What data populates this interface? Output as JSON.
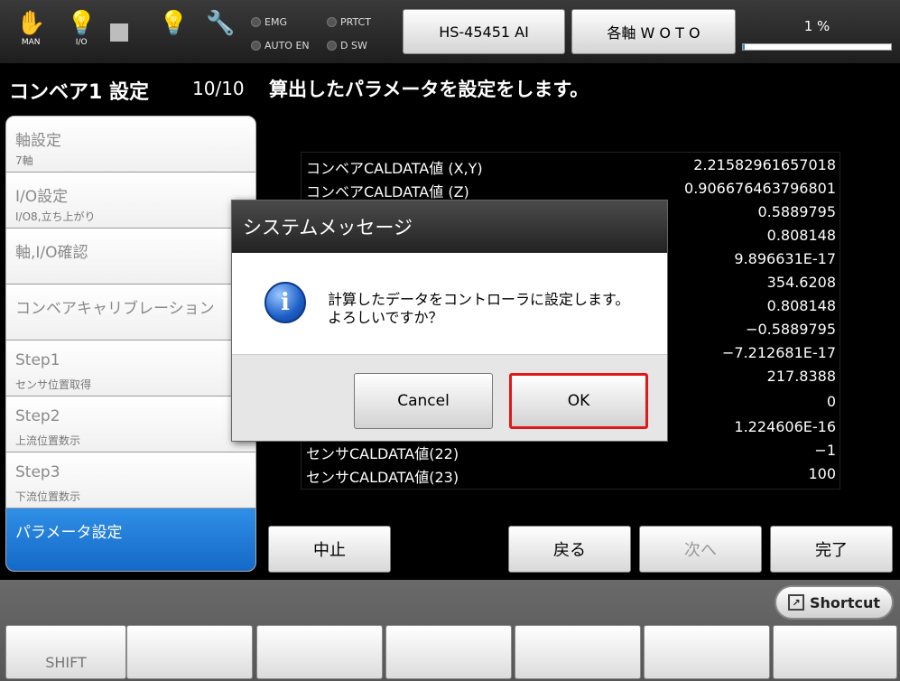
{
  "toolbar": {
    "icons": [
      {
        "name": "hand-icon",
        "caption": "MAN"
      },
      {
        "name": "io-bulb-icon",
        "caption": "I/O"
      },
      {
        "name": "stop-square-icon",
        "caption": ""
      },
      {
        "name": "bulb-icon",
        "caption": ""
      },
      {
        "name": "wrench-icon",
        "caption": ""
      }
    ],
    "leds": {
      "emg": "EMG",
      "prtct": "PRTCT",
      "auto_en": "AUTO EN",
      "dsw": "D SW"
    },
    "model_button": "HS-45451 AI",
    "axis_button": "各軸 W O T O",
    "progress_text": "1 %",
    "progress_fraction": 0.01
  },
  "sidebar": {
    "title": "コンベア1 設定",
    "page": "10/10",
    "steps": [
      {
        "title": "軸設定",
        "sub": "7軸"
      },
      {
        "title": "I/O設定",
        "sub": "I/O8,立ち上がり"
      },
      {
        "title": "軸,I/O確認",
        "sub": ""
      },
      {
        "title": "コンベアキャリブレーション",
        "sub": ""
      },
      {
        "title": "Step1",
        "sub": "センサ位置取得"
      },
      {
        "title": "Step2",
        "sub": "上流位置数示"
      },
      {
        "title": "Step3",
        "sub": "下流位置数示"
      },
      {
        "title": "パラメータ設定",
        "sub": ""
      }
    ]
  },
  "main": {
    "title": "算出したパラメータを設定をします。",
    "rows": [
      {
        "label": "コンベアCALDATA値 (X,Y)",
        "value": "2.21582961657018"
      },
      {
        "label": "コンベアCALDATA値 (Z)",
        "value": "0.906676463796801"
      },
      {
        "label": "",
        "value": "0.5889795"
      },
      {
        "label": "",
        "value": "0.808148"
      },
      {
        "label": "",
        "value": "9.896631E-17"
      },
      {
        "label": "",
        "value": "354.6208"
      },
      {
        "label": "",
        "value": "0.808148"
      },
      {
        "label": "",
        "value": "−0.5889795"
      },
      {
        "label": "",
        "value": "−7.212681E-17"
      },
      {
        "label": "",
        "value": "217.8388"
      },
      {
        "label": "",
        "value": "0"
      },
      {
        "label": "",
        "value": "1.224606E-16"
      },
      {
        "label": "センサCALDATA値(22)",
        "value": "−1"
      },
      {
        "label": "センサCALDATA値(23)",
        "value": "100"
      }
    ]
  },
  "nav": {
    "abort": "中止",
    "back": "戻る",
    "next": "次へ",
    "finish": "完了"
  },
  "bottom": {
    "shortcut": "Shortcut",
    "shift": "SHIFT"
  },
  "dialog": {
    "title": "システムメッセージ",
    "line1": "計算したデータをコントローラに設定します。",
    "line2": "よろしいですか？",
    "cancel": "Cancel",
    "ok": "OK"
  }
}
